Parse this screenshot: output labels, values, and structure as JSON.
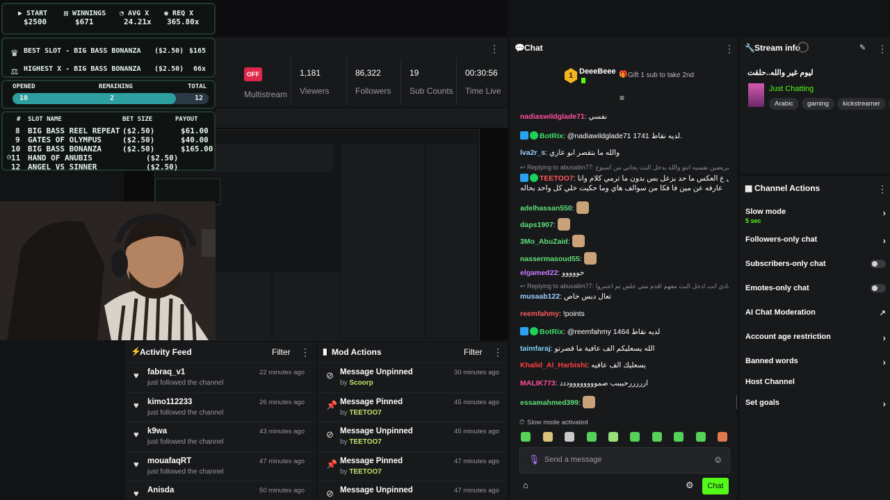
{
  "overlay": {
    "stats": [
      {
        "label": "START",
        "value": "$2500",
        "icon": "play-icon"
      },
      {
        "label": "WINNINGS",
        "value": "$671",
        "icon": "wallet-icon"
      },
      {
        "label": "AVG X",
        "value": "24.21x",
        "icon": "gauge-icon"
      },
      {
        "label": "REQ X",
        "value": "365.80x",
        "icon": "target-icon"
      }
    ],
    "best_slot": {
      "label": "BEST SLOT - BIG BASS BONANZA",
      "bet": "($2.50)",
      "win": "$165"
    },
    "highest_x": {
      "label": "HIGHEST X - BIG BASS BONANZA",
      "bet": "($2.50)",
      "win": "66x"
    },
    "progress": {
      "opened_label": "OPENED",
      "remaining_label": "REMAINING",
      "total_label": "TOTAL",
      "opened": "10",
      "remaining": "2",
      "total": "12",
      "fraction": 0.833
    },
    "slot_table": {
      "headers": {
        "num": "#",
        "name": "SLOT NAME",
        "bet": "BET SIZE",
        "payout": "PAYOUT"
      },
      "rows": [
        {
          "num": "8",
          "name": "BIG BASS REEL REPEAT",
          "bet": "($2.50)",
          "payout": "$61.00"
        },
        {
          "num": "9",
          "name": "GATES OF OLYMPUS",
          "bet": "($2.50)",
          "payout": "$40.00"
        },
        {
          "num": "10",
          "name": "BIG BASS BONANZA",
          "bet": "($2.50)",
          "payout": "$165.00"
        },
        {
          "num": "11",
          "name": "HAND OF ANUBIS",
          "bet": "($2.50)",
          "payout": ""
        },
        {
          "num": "12",
          "name": "ANGEL VS SINNER",
          "bet": "($2.50)",
          "payout": ""
        }
      ]
    }
  },
  "stats_bar": {
    "multistream_badge": "OFF",
    "multistream_label": "Multistream",
    "viewers": "1,181",
    "viewers_label": "Viewers",
    "followers": "86,322",
    "followers_label": "Followers",
    "subs": "19",
    "subs_label": "Sub Counts",
    "time": "00:30:56",
    "time_label": "Time Live"
  },
  "activity_feed": {
    "title": "Activity Feed",
    "filter": "Filter",
    "items": [
      {
        "name": "fabraq_v1",
        "action": "just followed the channel",
        "time": "22 minutes ago"
      },
      {
        "name": "kimo112233",
        "action": "just followed the channel",
        "time": "26 minutes ago"
      },
      {
        "name": "k9wa",
        "action": "just followed the channel",
        "time": "43 minutes ago"
      },
      {
        "name": "mouafaqRT",
        "action": "just followed the channel",
        "time": "47 minutes ago"
      },
      {
        "name": "Anisda",
        "action": "",
        "time": "50 minutes ago"
      }
    ]
  },
  "mod_actions": {
    "title": "Mod Actions",
    "filter": "Filter",
    "items": [
      {
        "action": "Message Unpinned",
        "by_label": "by",
        "by": "Scoorp",
        "time": "30 minutes ago"
      },
      {
        "action": "Message Pinned",
        "by_label": "by",
        "by": "TEETOO7",
        "time": "45 minutes ago"
      },
      {
        "action": "Message Unpinned",
        "by_label": "by",
        "by": "TEETOO7",
        "time": "45 minutes ago"
      },
      {
        "action": "Message Pinned",
        "by_label": "by",
        "by": "TEETOO7",
        "time": "47 minutes ago"
      },
      {
        "action": "Message Unpinned",
        "by_label": "",
        "by": "",
        "time": "47 minutes ago"
      }
    ]
  },
  "chat": {
    "title": "Chat",
    "top_gifter": "DeeeBeee",
    "top_rank": "1",
    "gift_text": "Gift 1 sub to take 2nd",
    "slow_mode_notice": "Slow mode activated",
    "input_placeholder": "Send a message",
    "send_label": "Chat",
    "messages": [
      {
        "user": "nadiaswildglade71",
        "text": "نفسي",
        "color": "#ff4fa0"
      },
      {
        "user": "BotRix",
        "text": "@nadiawildglade71 1741 لديه نقاط.",
        "color": "#3ee06a"
      },
      {
        "user": "lva2r_s",
        "text": "والله ما بتقصر ابو عازي",
        "color": "#9ad0ff"
      },
      {
        "reply": "Replying to abusalim77: ابو شلي مريضين نفسيه انتو والله بدخل البث يحاتي من اسبوع"
      },
      {
        "user": "TEETOO7",
        "text": "ياعمي ادخل ع العكس ما حد بزعل بس بدون ما ترمي كلام وانا",
        "color": "#ff5a5a"
      },
      {
        "user": "",
        "text": "عارفه عن مين فا فكا من سوالف هاي وما حكيت خلي كل واحد بحاله",
        "color": "#ffffff"
      },
      {
        "user": "adelhassan550",
        "text": "",
        "color": "#5ee07a"
      },
      {
        "user": "daps1907",
        "text": "",
        "color": "#5ee07a"
      },
      {
        "user": "3Mo_AbuZaid",
        "text": "",
        "color": "#5ee07a"
      },
      {
        "user": "nassermasoud55",
        "text": "",
        "color": "#5ee07a"
      },
      {
        "user": "elgamed22",
        "text": "خووووو",
        "color": "#c77dff"
      },
      {
        "reply": "Replying to abusalim77: شكلهم بدهش ابادي انت ادخل البث معهم اقدم متي خلص تم اعتبروا"
      },
      {
        "user": "musaab122",
        "text": "تعال دبس خاص",
        "color": "#9ad0ff"
      },
      {
        "user": "reemfahmy",
        "text": "!points",
        "color": "#ff5a5a"
      },
      {
        "user": "BotRix",
        "text": "@reemfahmy 1464 لديه نقاط",
        "color": "#3ee06a"
      },
      {
        "user": "taimfaraj",
        "text": "الله يسعليكم الف عافية ما قصرتو",
        "color": "#7fd3ff"
      },
      {
        "user": "Khalid_Al_Harbishi",
        "text": "يسعليك الف عافيه",
        "color": "#ff4040"
      },
      {
        "user": "MALIK773",
        "text": "ارررررحبببب صمووووووووددد",
        "color": "#ff4fa0"
      },
      {
        "user": "essamahmed399",
        "text": "",
        "color": "#5ee07a"
      }
    ]
  },
  "stream_info": {
    "title": "Stream info",
    "stream_title": "ليوم غير والله..حلقت",
    "category": "Just Chatting",
    "tags": [
      "Arabic",
      "gaming",
      "kickstreamer",
      "a"
    ]
  },
  "channel_actions": {
    "title": "Channel Actions",
    "items": [
      {
        "label": "Slow mode",
        "sub": "5 sec",
        "control": "chevron"
      },
      {
        "label": "Followers-only chat",
        "sub": "",
        "control": "chevron"
      },
      {
        "label": "Subscribers-only chat",
        "sub": "",
        "control": "toggle"
      },
      {
        "label": "Emotes-only chat",
        "sub": "",
        "control": "toggle"
      },
      {
        "label": "AI Chat Moderation",
        "sub": "",
        "control": "external"
      },
      {
        "label": "Account age restriction",
        "sub": "",
        "control": "chevron"
      },
      {
        "label": "Banned words",
        "sub": "",
        "control": "chevron"
      },
      {
        "label": "Host Channel",
        "sub": "",
        "control": "none"
      },
      {
        "label": "Set goals",
        "sub": "",
        "control": "chevron"
      }
    ]
  },
  "colors": {
    "accent": "#53fc18",
    "brand_green": "#1fd15a",
    "offline_red": "#e0284c",
    "panel": "#18191b"
  }
}
